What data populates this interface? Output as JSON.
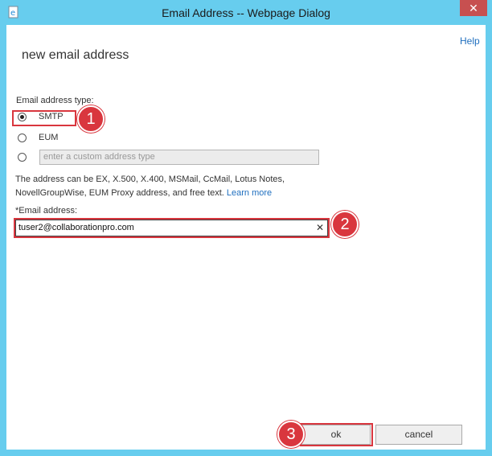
{
  "window": {
    "title": "Email Address -- Webpage Dialog",
    "close_symbol": "✕",
    "icon": "ie-page-icon"
  },
  "header": {
    "help_label": "Help",
    "page_title": "new email address"
  },
  "address_type": {
    "label": "Email address type:",
    "options": [
      {
        "label": "SMTP",
        "selected": true
      },
      {
        "label": "EUM",
        "selected": false
      },
      {
        "label": "",
        "selected": false
      }
    ],
    "custom_placeholder": "enter a custom address type"
  },
  "description": {
    "text": "The address can be EX, X.500, X.400, MSMail, CcMail, Lotus Notes, NovellGroupWise, EUM Proxy address, and free text.",
    "link": "Learn more"
  },
  "email": {
    "label": "*Email address:",
    "value": "tuser2@collaborationpro.com",
    "clear_symbol": "✕"
  },
  "buttons": {
    "ok": "ok",
    "cancel": "cancel"
  },
  "annotations": {
    "step1": "1",
    "step2": "2",
    "step3": "3",
    "color": "#d9363e"
  }
}
